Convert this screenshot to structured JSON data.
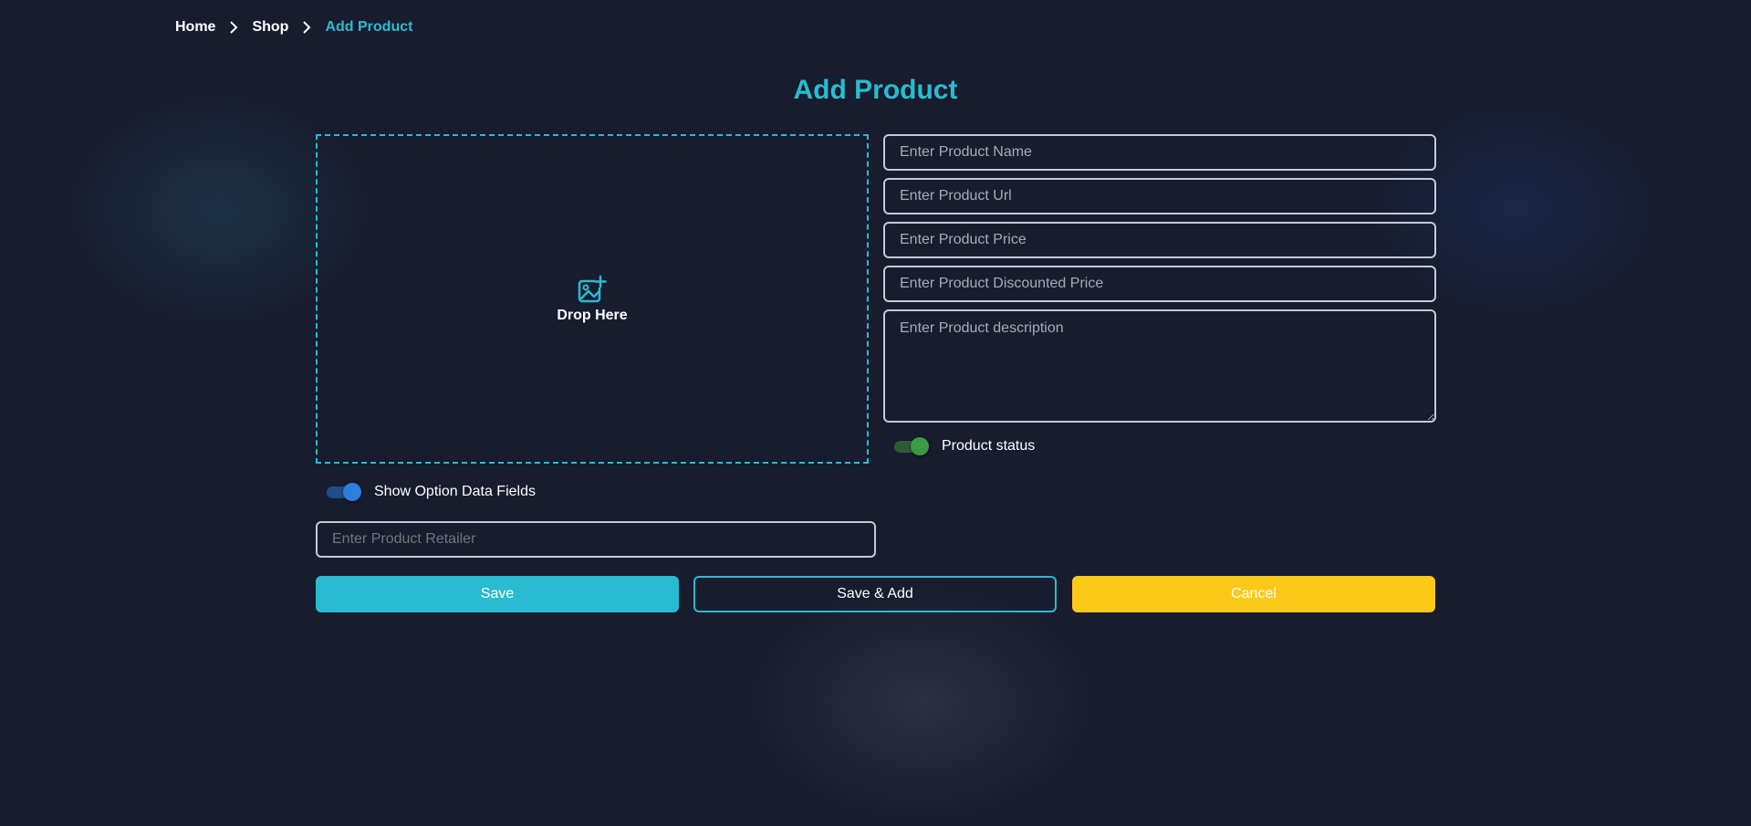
{
  "breadcrumb": {
    "items": [
      "Home",
      "Shop",
      "Add Product"
    ]
  },
  "page": {
    "title": "Add Product"
  },
  "dropzone": {
    "icon": "image-add-icon",
    "label": "Drop Here"
  },
  "form": {
    "name_placeholder": "Enter Product Name",
    "url_placeholder": "Enter Product Url",
    "price_placeholder": "Enter Product Price",
    "discount_placeholder": "Enter Product Discounted Price",
    "description_placeholder": "Enter Product description",
    "retailer_placeholder": "Enter Product Retailer",
    "status_label": "Product status",
    "status_on": true,
    "options_label": "Show Option Data Fields",
    "options_on": true
  },
  "actions": {
    "save_label": "Save",
    "save_add_label": "Save & Add",
    "cancel_label": "Cancel"
  },
  "colors": {
    "background": "#171c2e",
    "accent": "#29bcd0",
    "cancel": "#fbc918",
    "status_toggle": "#3a9a45",
    "options_toggle": "#2f7ede"
  }
}
